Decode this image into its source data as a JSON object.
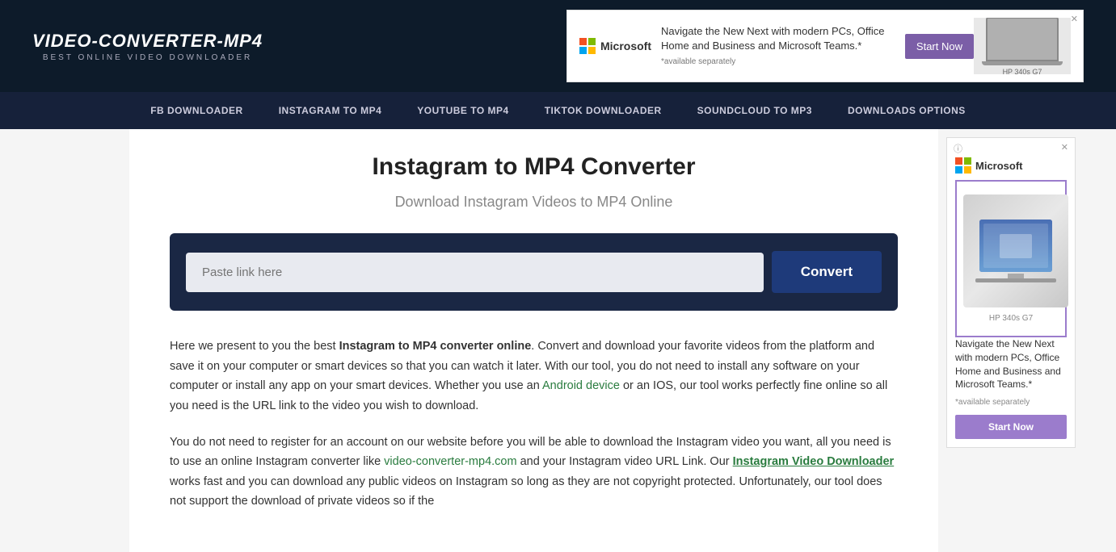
{
  "header": {
    "logo_title": "VIDEO-CONVERTER-MP4",
    "logo_subtitle": "BEST ONLINE VIDEO DOWNLOADER",
    "ad_close": "✕",
    "ad_ms_label": "Microsoft",
    "ad_text": "Navigate the New Next with modern PCs, Office Home and Business and Microsoft Teams.*",
    "ad_text_small": "*available separately",
    "ad_cta": "Start Now",
    "ad_image_label": "HP 340s G7"
  },
  "nav": {
    "items": [
      {
        "label": "FB DOWNLOADER",
        "href": "#"
      },
      {
        "label": "INSTAGRAM TO MP4",
        "href": "#"
      },
      {
        "label": "YOUTUBE TO MP4",
        "href": "#"
      },
      {
        "label": "TIKTOK DOWNLOADER",
        "href": "#"
      },
      {
        "label": "SOUNDCLOUD TO MP3",
        "href": "#"
      },
      {
        "label": "DOWNLOADS OPTIONS",
        "href": "#"
      }
    ]
  },
  "main": {
    "title": "Instagram to MP4 Converter",
    "subtitle": "Download Instagram Videos to MP4 Online",
    "input_placeholder": "Paste link here",
    "convert_button": "Convert",
    "body_paragraph1_pre": "Here we present to you the best ",
    "body_paragraph1_bold": "Instagram to MP4 converter online",
    "body_paragraph1_post": ". Convert and download your favorite videos from the platform and save it on your computer or smart devices so that you can watch it later. With our tool, you do not need to install any software on your computer or install any app on your smart devices. Whether you use an ",
    "body_paragraph1_link": "Android device",
    "body_paragraph1_post2": " or an IOS, our tool works perfectly fine online so all you need is the URL link to the video you wish to download.",
    "body_paragraph2_pre": "You do not need to register for an account on our website before you will be able to download the Instagram video you want, all you need is to use an online Instagram converter like ",
    "body_paragraph2_link1": "video-converter-mp4.com",
    "body_paragraph2_mid": " and your Instagram video URL Link. Our ",
    "body_paragraph2_link2": "Instagram Video Downloader",
    "body_paragraph2_post": " works fast and you can download any public videos on Instagram so long as they are not copyright protected. Unfortunately, our tool does not support the download of private videos so if the"
  },
  "sidebar_ad": {
    "info_icon": "ⓘ",
    "close_icon": "✕",
    "ms_label": "Microsoft",
    "laptop_label": "HP 340s G7",
    "body_text": "Navigate the New Next with modern PCs, Office Home and Business and Microsoft Teams.*",
    "small_text": "*available separately",
    "cta": "Start Now"
  }
}
